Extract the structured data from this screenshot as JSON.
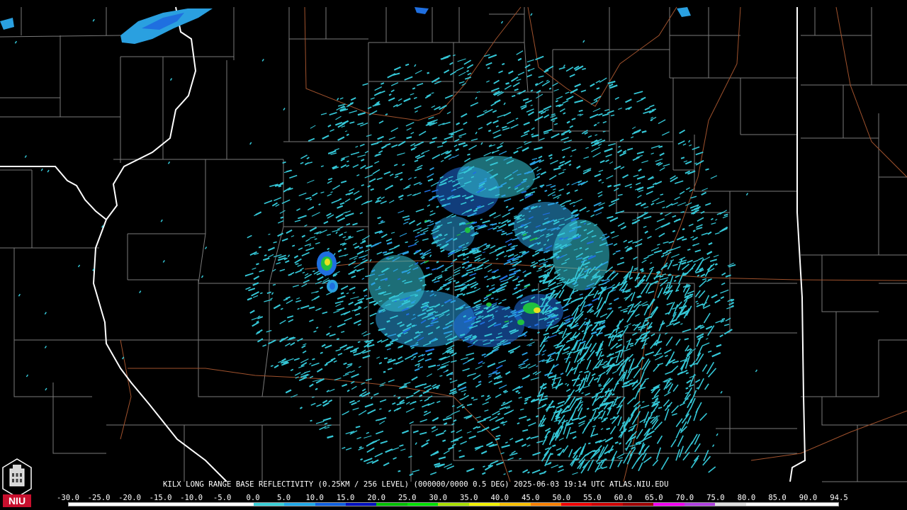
{
  "product": {
    "site": "KILX",
    "title_line": "KILX LONG RANGE BASE REFLECTIVITY (0.25KM / 256 LEVEL) (000000/0000 0.5 DEG) 2025-06-03 19:14 UTC  ATLAS.NIU.EDU",
    "timestamp": "2025-06-03 19:14 UTC",
    "source": "ATLAS.NIU.EDU"
  },
  "logo": {
    "text": "NIU",
    "icon": "university-tower-icon"
  },
  "scale": {
    "labels": [
      "-30.0",
      "-25.0",
      "-20.0",
      "-15.0",
      "-10.0",
      "-5.0",
      "0.0",
      "5.0",
      "10.0",
      "15.0",
      "20.0",
      "25.0",
      "30.0",
      "35.0",
      "40.0",
      "45.0",
      "50.0",
      "55.0",
      "60.0",
      "65.0",
      "70.0",
      "75.0",
      "80.0",
      "85.0",
      "90.0",
      "94.5"
    ],
    "colors": [
      "#ffffff",
      "#ffffff",
      "#ffffff",
      "#ffffff",
      "#ffffff",
      "#ffffff",
      "#3ad0d8",
      "#20a8e8",
      "#1060e0",
      "#0010c0",
      "#00c000",
      "#00e000",
      "#a8e000",
      "#f0f000",
      "#f8c000",
      "#f88000",
      "#f00000",
      "#d00000",
      "#a00000",
      "#f000f0",
      "#b040e0",
      "#e0e0e0",
      "#ffffff",
      "#ffffff",
      "#ffffff"
    ]
  },
  "map": {
    "background": "#000000",
    "county_line_color": "#7a7a7a",
    "state_line_color": "#ffffff",
    "highway_color": "#a0522d",
    "echo_colors": [
      "#35c8d8",
      "#2aa0e0",
      "#1f6fe0",
      "#1040c8",
      "#20c040",
      "#e8e020"
    ]
  }
}
